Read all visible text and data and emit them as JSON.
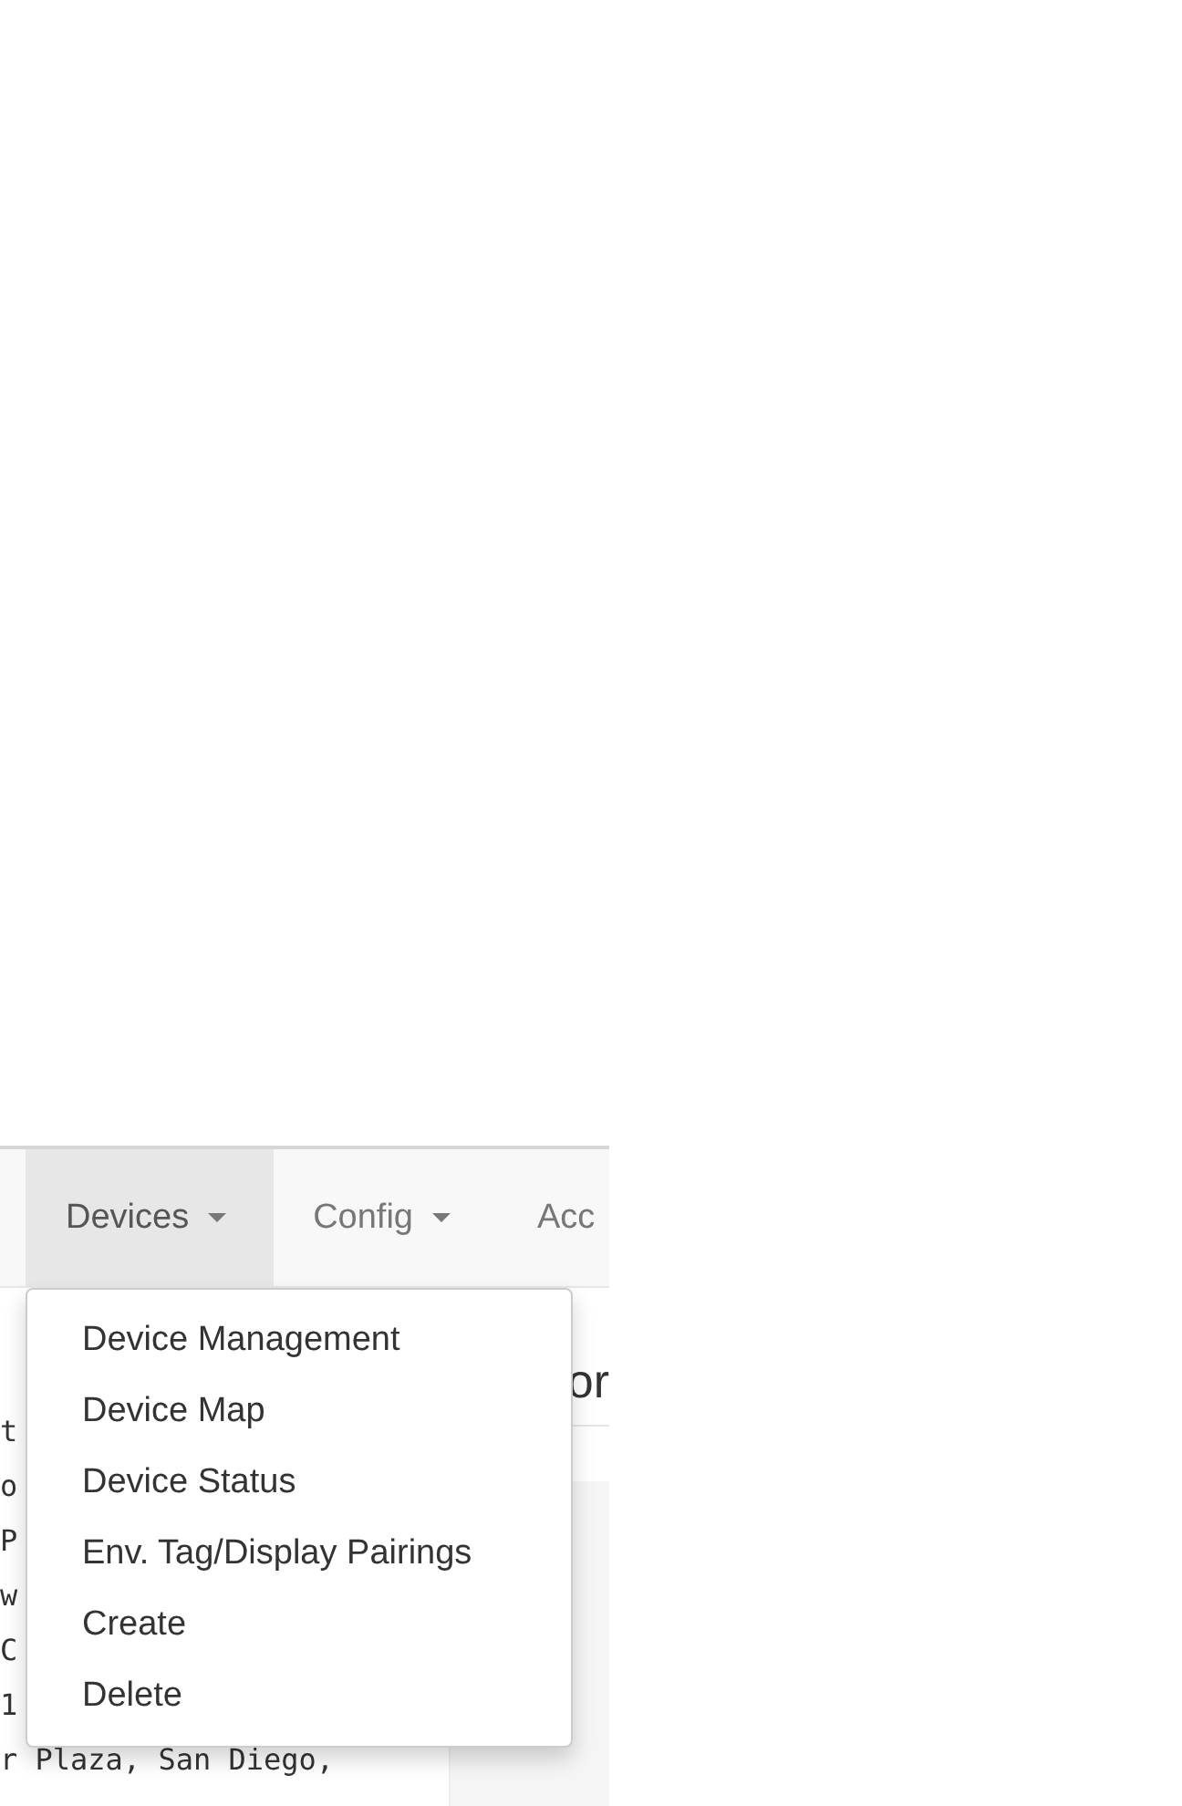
{
  "navbar": {
    "items": [
      {
        "label": "Devices",
        "selected": true,
        "dropdown": true
      },
      {
        "label": "Config",
        "selected": false,
        "dropdown": true
      },
      {
        "label": "Acc",
        "selected": false,
        "dropdown": false
      }
    ]
  },
  "dropdown_menu": {
    "items": [
      "Device Management",
      "Device Map",
      "Device Status",
      "Env. Tag/Display Pairings",
      "Create",
      "Delete"
    ]
  },
  "address_text": {
    "lines": [
      "t",
      "o",
      "P",
      "w",
      "C",
      "1",
      "r Plaza, San Diego,"
    ]
  },
  "heading": "or"
}
